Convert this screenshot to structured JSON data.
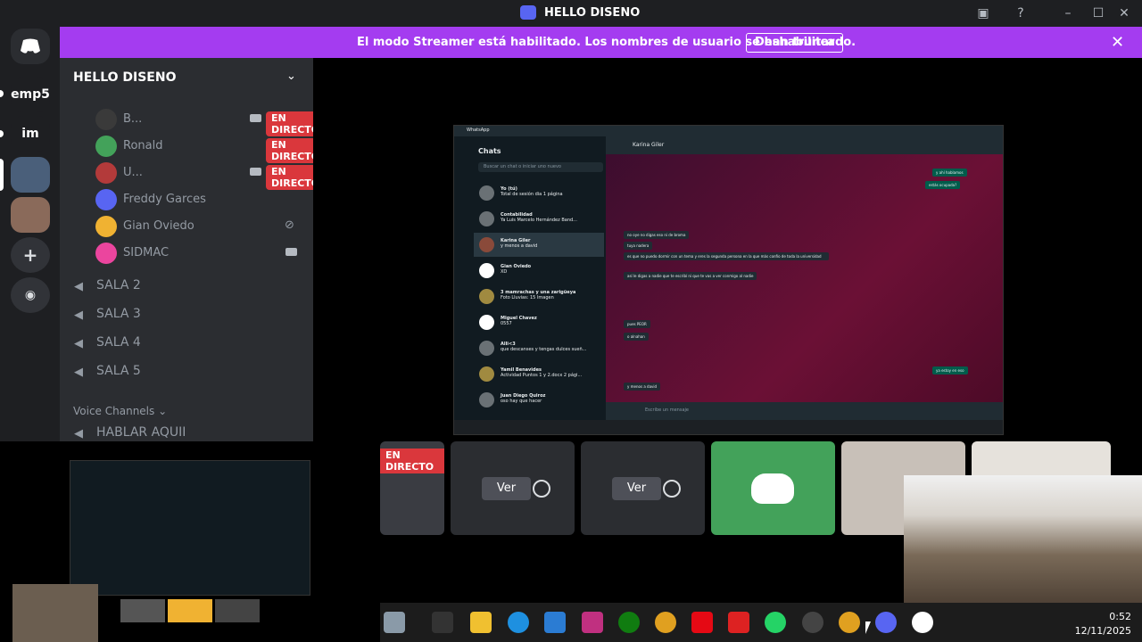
{
  "window": {
    "title": "HELLO DISENO"
  },
  "banner": {
    "message": "El modo Streamer está habilitado. Los nombres de usuario se han truncado.",
    "button": "Deshabilitar"
  },
  "servers": [
    {
      "label": "emp5"
    },
    {
      "label": "im"
    }
  ],
  "server": {
    "name": "HELLO DISENO"
  },
  "members": [
    {
      "name": "B...",
      "live": "EN DIRECTO",
      "color": "#3a3a3a"
    },
    {
      "name": "Ronald",
      "live": "EN DIRECTO",
      "color": "#43a25a"
    },
    {
      "name": "U...",
      "live": "EN DIRECTO",
      "color": "#b33a3a"
    },
    {
      "name": "Freddy Garces",
      "live": "",
      "color": "#5865f2"
    },
    {
      "name": "Gian Oviedo",
      "live": "",
      "color": "#f0b232"
    },
    {
      "name": "SIDMAC",
      "live": "",
      "color": "#eb459e"
    }
  ],
  "voice_channels": [
    {
      "name": "SALA 2"
    },
    {
      "name": "SALA 3"
    },
    {
      "name": "SALA 4"
    },
    {
      "name": "SALA 5"
    }
  ],
  "voice_category": "Voice Channels",
  "voice_channel_extra": "HABLAR AQUII",
  "whatsapp": {
    "app_title": "WhatsApp",
    "chats_title": "Chats",
    "search_placeholder": "Buscar un chat o iniciar uno nuevo",
    "contact": "Karina Giler",
    "chats": [
      {
        "name": "Yo (tú)",
        "preview": "Total de sesión dia 1 página"
      },
      {
        "name": "Contabilidad",
        "preview": "Ya Luis Marcelo Hernández Band..."
      },
      {
        "name": "Karina Giler",
        "preview": "y menos a david"
      },
      {
        "name": "Gian Oviedo",
        "preview": "XD"
      },
      {
        "name": "3 mamrachas y una zarigüeya",
        "preview": "Foto Lluvias: 15 Imagen"
      },
      {
        "name": "Miguel Chavez",
        "preview": "0557"
      },
      {
        "name": "Alli<3",
        "preview": "que descanses y tengas dulces sueñ..."
      },
      {
        "name": "Yamil Benavides",
        "preview": "Actividad Puntos 1 y 2.docx 2 pági..."
      },
      {
        "name": "Juan Diego Quiroz",
        "preview": "oso hay que hacer"
      }
    ],
    "messages_in": [
      "y menos a david",
      "pues PEOR",
      "o alnahan",
      "no oye no digas eso ni de broma",
      "tuya nadera",
      "es que no puedo dormir con un tema y eres la segunda persona en la que más confío de toda la universidad",
      "así le digas a nadie que te escribí ni que te vas a ver conmigo al nadie"
    ],
    "messages_out": [
      "y ahí hablamos",
      "estás ocupada?",
      "ya estoy en eso"
    ],
    "input_placeholder": "Escribe un mensaje"
  },
  "stage_tiles": [
    {
      "label": "EN DIRECTO"
    },
    {
      "label": "Ver"
    },
    {
      "label": "Ver"
    }
  ],
  "taskbar": {
    "time": "0:52",
    "date": "12/11/2025"
  }
}
